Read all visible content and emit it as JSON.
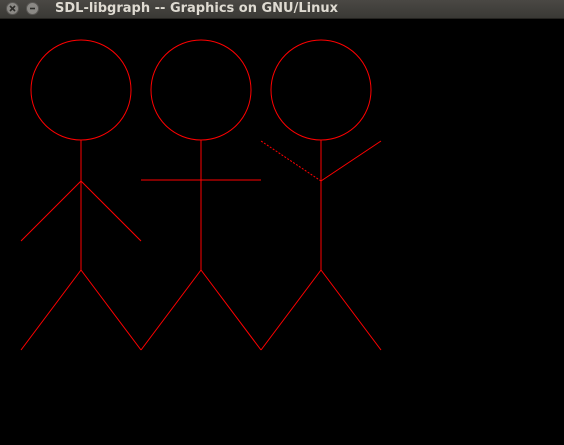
{
  "window": {
    "title": "SDL-libgraph -- Graphics on GNU/Linux",
    "close_icon": "close-icon",
    "minimize_icon": "minimize-icon"
  },
  "canvas": {
    "background": "#000000",
    "stroke_color": "#ff0000",
    "figures": [
      {
        "name": "stick-figure-left",
        "pose": "arms-down"
      },
      {
        "name": "stick-figure-middle",
        "pose": "arms-horizontal"
      },
      {
        "name": "stick-figure-right",
        "pose": "arms-raised"
      }
    ]
  }
}
